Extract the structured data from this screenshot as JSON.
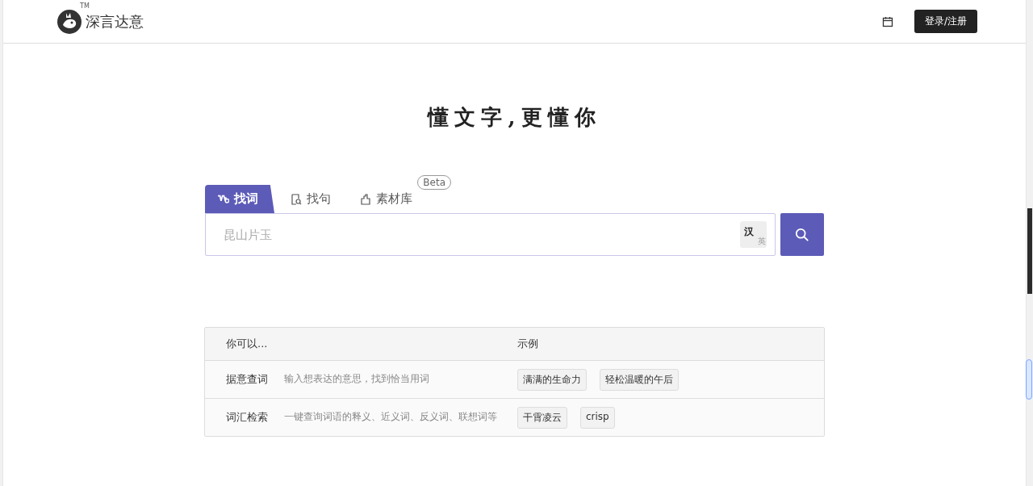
{
  "header": {
    "logo_text": "深言达意",
    "trademark": "TM",
    "login_button": "登录/注册"
  },
  "headline": "懂文字,更懂你",
  "tabs": [
    {
      "label": "找词",
      "selected": true
    },
    {
      "label": "找句",
      "selected": false
    },
    {
      "label": "素材库",
      "selected": false,
      "badge": "Beta"
    }
  ],
  "search": {
    "placeholder": "昆山片玉",
    "language_toggle": {
      "primary": "汉",
      "secondary": "英"
    }
  },
  "table": {
    "columns": [
      "你可以...",
      "示例"
    ],
    "rows": [
      {
        "feature": "据意查词",
        "description": "输入想表达的意思，找到恰当用词",
        "examples": [
          "满满的生命力",
          "轻松温暖的午后"
        ]
      },
      {
        "feature": "词汇检索",
        "description": "一键查询词语的释义、近义词、反义词、联想词等",
        "examples": [
          "干霄凌云",
          "crisp"
        ]
      }
    ]
  }
}
